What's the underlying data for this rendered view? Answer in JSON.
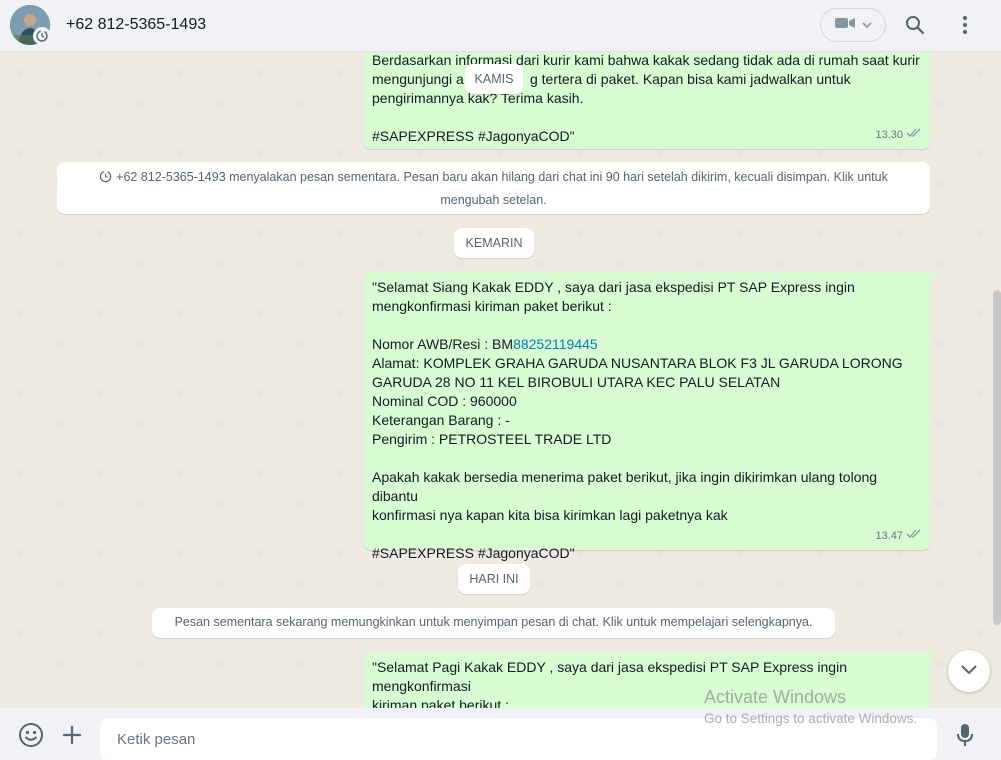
{
  "header": {
    "contact_name": "+62 812-5365-1493"
  },
  "messages": {
    "first": {
      "lines": [
        "Berdasarkan informasi dari kurir kami bahwa kakak sedang tidak ada di rumah saat kurir",
        "mengunjungi a                 g tertera di paket. Kapan bisa kami jadwalkan untuk",
        "pengirimannya kak? Terima kasih.",
        "",
        "#SAPEXPRESS #JagonyaCOD\""
      ],
      "time": "13.30"
    },
    "second": {
      "line1": "\"Selamat Siang Kakak EDDY , saya dari jasa ekspedisi PT SAP Express ingin",
      "line2": "mengkonfirmasi kiriman paket berikut :",
      "awb_prefix": "Nomor AWB/Resi : BM",
      "awb_number": "88252119445",
      "line_address1": "Alamat: KOMPLEK GRAHA GARUDA NUSANTARA BLOK F3 JL GARUDA LORONG",
      "line_address2": "GARUDA 28 NO 11 KEL BIROBULI UTARA KEC PALU SELATAN",
      "line_cod": "Nominal COD : 960000",
      "line_note": "Keterangan Barang : -",
      "line_sender": "Pengirim : PETROSTEEL TRADE LTD",
      "line_ask1": "Apakah kakak bersedia menerima paket berikut, jika ingin dikirimkan ulang tolong dibantu",
      "line_ask2": "konfirmasi nya kapan kita bisa kirimkan lagi paketnya kak",
      "line_tags": "#SAPEXPRESS #JagonyaCOD\"",
      "time": "13.47"
    },
    "third": {
      "line1": "\"Selamat Pagi Kakak EDDY , saya dari jasa ekspedisi PT SAP Express ingin mengkonfirmasi",
      "line2": "kiriman paket berikut :"
    }
  },
  "date_chips": {
    "kamis": "KAMIS",
    "kemarin": "KEMARIN",
    "hari_ini": "HARI INI"
  },
  "system_messages": {
    "disappearing_line1": "+62 812-5365-1493 menyalakan pesan sementara. Pesan baru akan hilang dari chat ini 90 hari setelah dikirim, kecuali disimpan. Klik untuk",
    "disappearing_line2": "mengubah setelan.",
    "keep_info": "Pesan sementara sekarang memungkinkan untuk menyimpan pesan di chat. Klik untuk mempelajari selengkapnya."
  },
  "composer": {
    "placeholder": "Ketik pesan"
  },
  "watermark": {
    "title": "Activate Windows",
    "subtitle": "Go to Settings to activate Windows."
  },
  "icons": {
    "video": "video-camera-icon",
    "search": "search-icon",
    "menu": "kebab-menu-icon",
    "emoji": "emoji-icon",
    "attach": "plus-icon",
    "mic": "microphone-icon",
    "scroll": "chevron-down-icon",
    "ticks": "double-check-icon",
    "timer": "timer-icon"
  },
  "colors": {
    "outgoing_bubble": "#d9fdd3",
    "chat_background": "#efeae2",
    "link": "#027eb5"
  }
}
